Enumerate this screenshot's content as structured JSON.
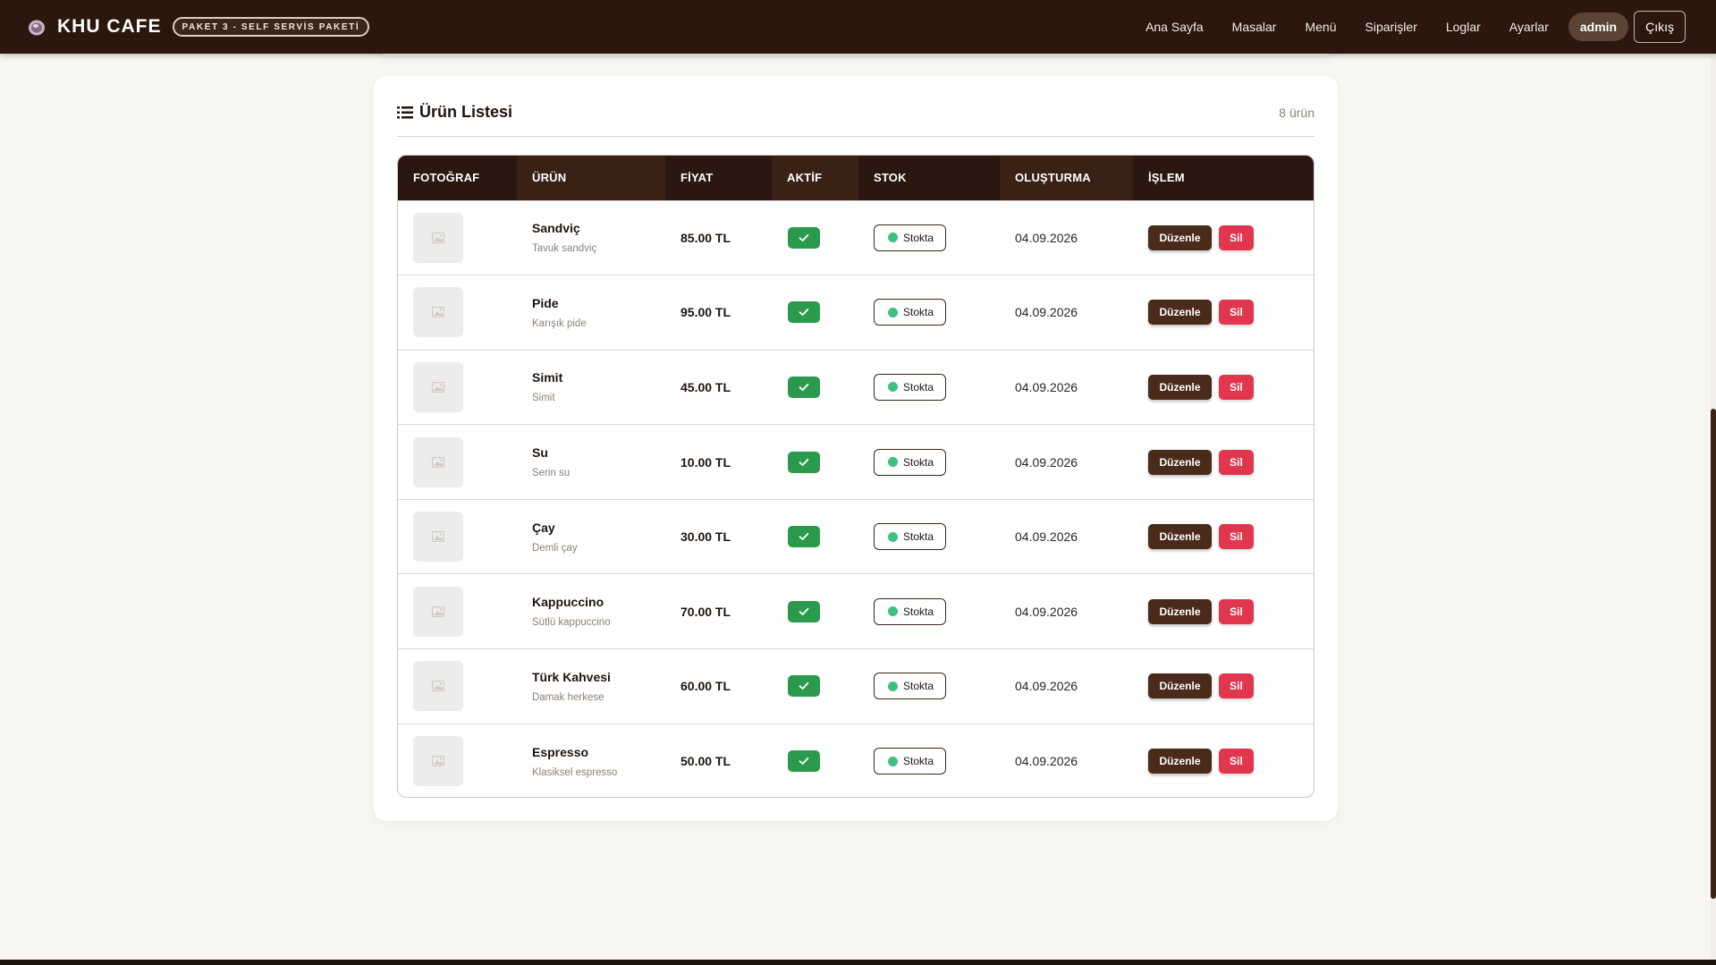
{
  "navbar": {
    "brand": "KHU CAFE",
    "badge": "PAKET 3 - SELF SERVİS PAKETİ",
    "links": [
      "Ana Sayfa",
      "Masalar",
      "Menü",
      "Siparişler",
      "Loglar",
      "Ayarlar"
    ],
    "user": "admin",
    "logout": "Çıkış"
  },
  "card": {
    "title": "Ürün Listesi",
    "count": "8 ürün"
  },
  "table": {
    "headers": [
      "FOTOĞRAF",
      "ÜRÜN",
      "FİYAT",
      "AKTİF",
      "STOK",
      "OLUŞTURMA",
      "İŞLEM"
    ],
    "rows": [
      {
        "name": "Sandviç",
        "desc": "Tavuk sandviç",
        "price": "85.00 TL",
        "stock": "Stokta",
        "date": "04.09.2026",
        "edit": "Düzenle",
        "delete": "Sil"
      },
      {
        "name": "Pide",
        "desc": "Karışık pide",
        "price": "95.00 TL",
        "stock": "Stokta",
        "date": "04.09.2026",
        "edit": "Düzenle",
        "delete": "Sil"
      },
      {
        "name": "Simit",
        "desc": "Simit",
        "price": "45.00 TL",
        "stock": "Stokta",
        "date": "04.09.2026",
        "edit": "Düzenle",
        "delete": "Sil"
      },
      {
        "name": "Su",
        "desc": "Serin su",
        "price": "10.00 TL",
        "stock": "Stokta",
        "date": "04.09.2026",
        "edit": "Düzenle",
        "delete": "Sil"
      },
      {
        "name": "Çay",
        "desc": "Demli çay",
        "price": "30.00 TL",
        "stock": "Stokta",
        "date": "04.09.2026",
        "edit": "Düzenle",
        "delete": "Sil"
      },
      {
        "name": "Kappuccino",
        "desc": "Sütlü kappuccino",
        "price": "70.00 TL",
        "stock": "Stokta",
        "date": "04.09.2026",
        "edit": "Düzenle",
        "delete": "Sil"
      },
      {
        "name": "Türk Kahvesi",
        "desc": "Damak herkese",
        "price": "60.00 TL",
        "stock": "Stokta",
        "date": "04.09.2026",
        "edit": "Düzenle",
        "delete": "Sil"
      },
      {
        "name": "Espresso",
        "desc": "Klasiksel espresso",
        "price": "50.00 TL",
        "stock": "Stokta",
        "date": "04.09.2026",
        "edit": "Düzenle",
        "delete": "Sil"
      }
    ]
  },
  "icons": {
    "brand": "coffee-cup-icon",
    "list": "list-icon",
    "photo": "image-placeholder-icon",
    "active": "check-icon",
    "stock": "status-dot-icon"
  },
  "colors": {
    "navbar": "#2c170e",
    "edit_button": "#4a2b1b",
    "delete_button": "#e0374f",
    "active_check": "#2c9a4c",
    "stock_dot": "#3fbf82",
    "background": "#f8f6f1"
  }
}
